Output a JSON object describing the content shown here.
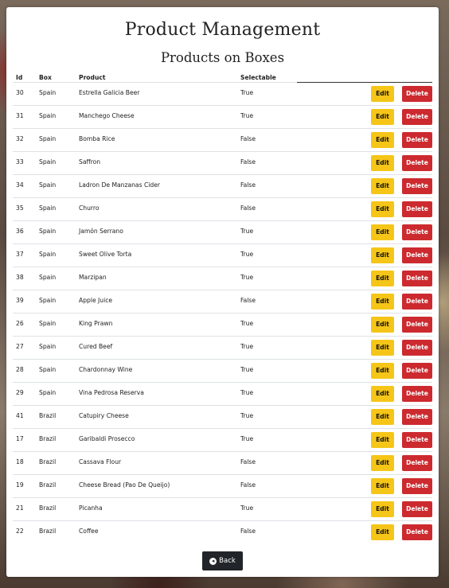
{
  "page": {
    "title": "Product Management",
    "subtitle": "Products on Boxes"
  },
  "table": {
    "headers": {
      "id": "Id",
      "box": "Box",
      "product": "Product",
      "selectable": "Selectable"
    },
    "rows": [
      {
        "id": "30",
        "box": "Spain",
        "product": "Estrella Galicia Beer",
        "selectable": "True"
      },
      {
        "id": "31",
        "box": "Spain",
        "product": "Manchego Cheese",
        "selectable": "True"
      },
      {
        "id": "32",
        "box": "Spain",
        "product": "Bomba Rice",
        "selectable": "False"
      },
      {
        "id": "33",
        "box": "Spain",
        "product": "Saffron",
        "selectable": "False"
      },
      {
        "id": "34",
        "box": "Spain",
        "product": "Ladron De Manzanas Cider",
        "selectable": "False"
      },
      {
        "id": "35",
        "box": "Spain",
        "product": "Churro",
        "selectable": "False"
      },
      {
        "id": "36",
        "box": "Spain",
        "product": "Jamón Serrano",
        "selectable": "True"
      },
      {
        "id": "37",
        "box": "Spain",
        "product": "Sweet Olive Torta",
        "selectable": "True"
      },
      {
        "id": "38",
        "box": "Spain",
        "product": "Marzipan",
        "selectable": "True"
      },
      {
        "id": "39",
        "box": "Spain",
        "product": "Apple Juice",
        "selectable": "False"
      },
      {
        "id": "26",
        "box": "Spain",
        "product": "King Prawn",
        "selectable": "True"
      },
      {
        "id": "27",
        "box": "Spain",
        "product": "Cured Beef",
        "selectable": "True"
      },
      {
        "id": "28",
        "box": "Spain",
        "product": "Chardonnay Wine",
        "selectable": "True"
      },
      {
        "id": "29",
        "box": "Spain",
        "product": "Vina Pedrosa Reserva",
        "selectable": "True"
      },
      {
        "id": "41",
        "box": "Brazil",
        "product": "Catupiry Cheese",
        "selectable": "True"
      },
      {
        "id": "17",
        "box": "Brazil",
        "product": "Garibaldi Prosecco",
        "selectable": "True"
      },
      {
        "id": "18",
        "box": "Brazil",
        "product": "Cassava Flour",
        "selectable": "False"
      },
      {
        "id": "19",
        "box": "Brazil",
        "product": "Cheese Bread (Pao De Queijo)",
        "selectable": "False"
      },
      {
        "id": "21",
        "box": "Brazil",
        "product": "Picanha",
        "selectable": "True"
      },
      {
        "id": "22",
        "box": "Brazil",
        "product": "Coffee",
        "selectable": "False"
      }
    ],
    "edit_label": "Edit",
    "delete_label": "Delete"
  },
  "footer": {
    "back_label": "Back",
    "back_icon": "arrow-left-circle-icon"
  },
  "colors": {
    "edit": "#f5c518",
    "delete": "#cc2a2f",
    "back": "#212529"
  }
}
